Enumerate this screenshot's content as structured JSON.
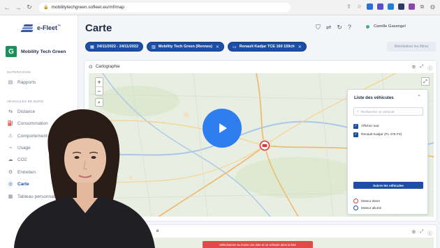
{
  "browser": {
    "url": "mobilitytechgreen.sofleet.eu/mf/map"
  },
  "brand": {
    "name": "e-Fleet",
    "tm": "™",
    "color": "#2b3a67"
  },
  "organization": {
    "initial": "G",
    "name": "Mobility Tech Green",
    "color": "#1e8e5a"
  },
  "sidebar": {
    "sections": [
      {
        "title": "SUPERVISION",
        "items": [
          {
            "label": "Rapports",
            "icon": "report-icon",
            "glyph": "▤",
            "active": false
          }
        ]
      },
      {
        "title": "VÉHICULES DE BORD",
        "items": [
          {
            "label": "Distance",
            "icon": "distance-icon",
            "glyph": "⇆",
            "active": false
          },
          {
            "label": "Consommation",
            "icon": "fuel-icon",
            "glyph": "⛽",
            "active": false
          },
          {
            "label": "Comportement",
            "icon": "behavior-icon",
            "glyph": "⚠",
            "active": false
          },
          {
            "label": "Usage",
            "icon": "usage-icon",
            "glyph": "⌁",
            "active": false
          },
          {
            "label": "CO2",
            "icon": "co2-icon",
            "glyph": "☁",
            "active": false
          },
          {
            "label": "Entretien",
            "icon": "maintenance-icon",
            "glyph": "⚙",
            "active": false
          },
          {
            "label": "Carte",
            "icon": "map-icon",
            "glyph": "◎",
            "active": true
          },
          {
            "label": "Tableau personnalisé",
            "icon": "dashboard-icon",
            "glyph": "▦",
            "active": false
          }
        ]
      }
    ]
  },
  "header": {
    "title": "Carte",
    "user": "Camille Gasengel",
    "status_color": "#3cb371"
  },
  "filters": {
    "chips": [
      {
        "label": "24/11/2022 - 24/11/2022",
        "icon": "calendar-icon",
        "glyph": "▦",
        "removable": false
      },
      {
        "label": "Mobility Tech Green (Rennes)",
        "icon": "building-icon",
        "glyph": "▥",
        "removable": true
      },
      {
        "label": "Renault Kadjar TCE 160 159ch",
        "icon": "car-icon",
        "glyph": "▭",
        "removable": true
      }
    ],
    "reset_label": "Réinitialiser les filtres",
    "accent": "#1c4ea8"
  },
  "map_card": {
    "title": "Cartographie"
  },
  "vehicle_panel": {
    "title": "Liste des véhicules",
    "search_placeholder": "Rechercher un véhicule",
    "show_all_label": "Afficher tout",
    "vehicle_label": "Renault Kadjar (FL 475 FS)",
    "button_label": "Suivre les véhicules",
    "legend_off": "Moteur éteint",
    "legend_on": "Moteur allumé",
    "off_color": "#d93a3a",
    "on_color": "#1c4ea8"
  },
  "second_card": {
    "title": "e"
  },
  "alert": {
    "text": "Sélectionnez au moins une date et un véhicule dans la liste",
    "color": "#e24a4a"
  }
}
